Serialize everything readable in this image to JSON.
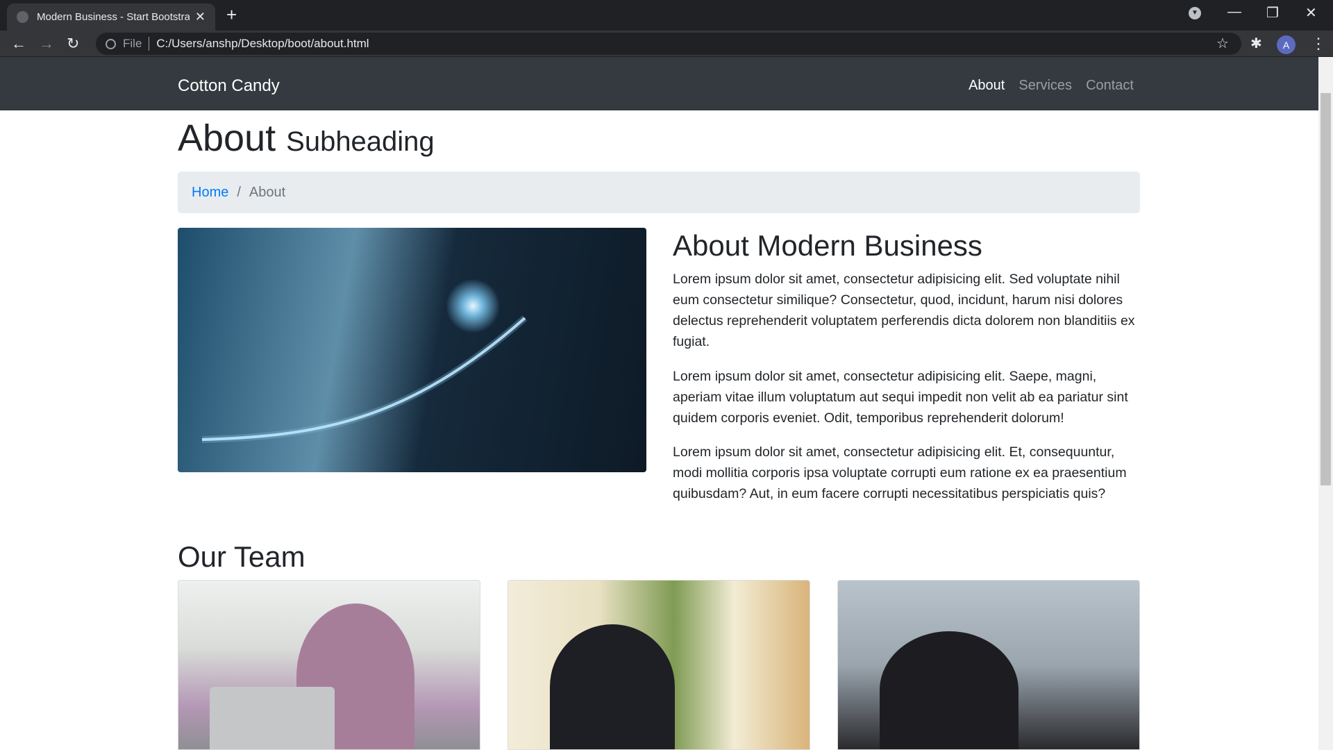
{
  "browser": {
    "tab_title": "Modern Business - Start Bootstrap Template",
    "address_prefix": "File",
    "url": "C:/Users/anshp/Desktop/boot/about.html",
    "profile_initial": "A"
  },
  "navbar": {
    "brand": "Cotton Candy",
    "links": [
      {
        "label": "About",
        "active": true
      },
      {
        "label": "Services"
      },
      {
        "label": "Contact"
      }
    ]
  },
  "page": {
    "title": "About",
    "subtitle": "Subheading",
    "breadcrumb": [
      "Home",
      "About"
    ],
    "about_heading": "About Modern Business",
    "paragraphs": [
      "Lorem ipsum dolor sit amet, consectetur adipisicing elit. Sed voluptate nihil eum consectetur similique? Consectetur, quod, incidunt, harum nisi dolores delectus reprehenderit voluptatem perferendis dicta dolorem non blanditiis ex fugiat.",
      "Lorem ipsum dolor sit amet, consectetur adipisicing elit. Saepe, magni, aperiam vitae illum voluptatum aut sequi impedit non velit ab ea pariatur sint quidem corporis eveniet. Odit, temporibus reprehenderit dolorum!",
      "Lorem ipsum dolor sit amet, consectetur adipisicing elit. Et, consequuntur, modi mollitia corporis ipsa voluptate corrupti eum ratione ex ea praesentium quibusdam? Aut, in eum facere corrupti necessitatibus perspiciatis quis?"
    ],
    "team_heading": "Our Team"
  }
}
